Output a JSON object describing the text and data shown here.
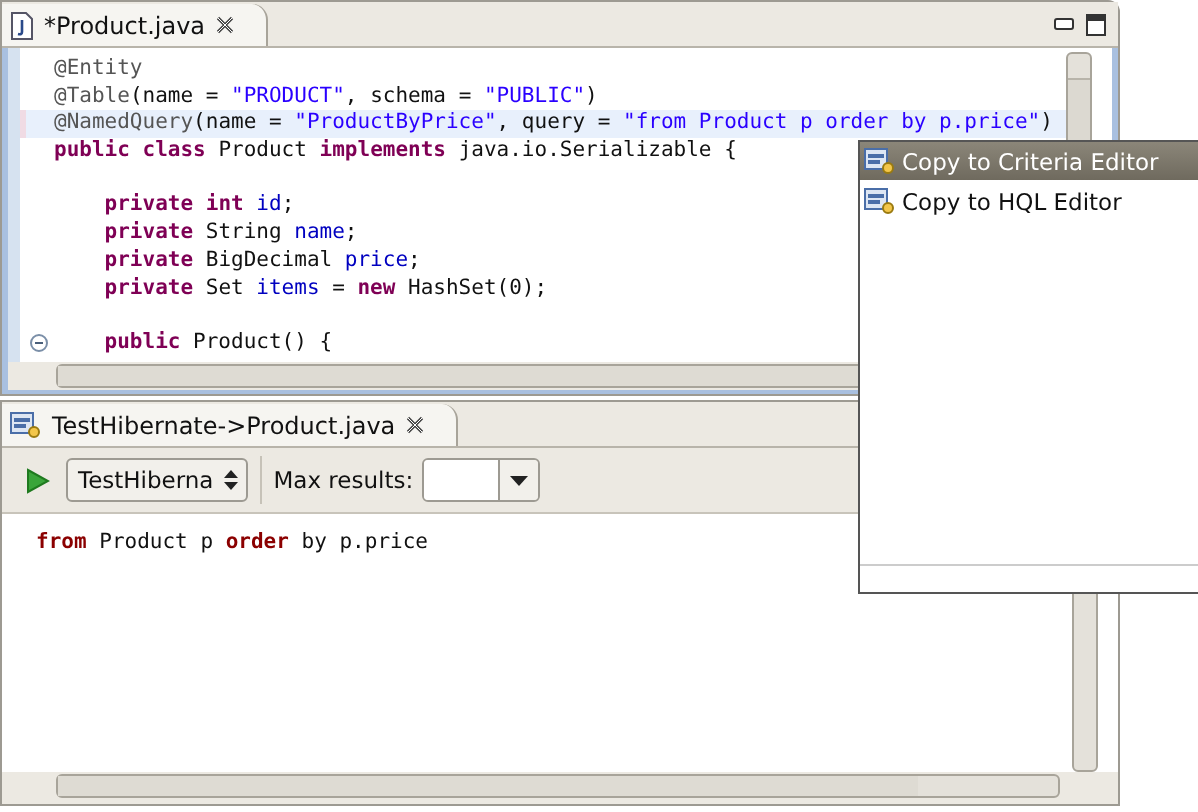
{
  "java_editor": {
    "tab": {
      "title": "*Product.java",
      "selected": true
    },
    "lines": [
      {
        "current": false,
        "tokens": [
          {
            "kind": "annotation",
            "text": "@Entity"
          }
        ]
      },
      {
        "current": false,
        "tokens": [
          {
            "kind": "annotation",
            "text": "@Table"
          },
          {
            "kind": "plain",
            "text": "(name = "
          },
          {
            "kind": "string",
            "text": "\"PRODUCT\""
          },
          {
            "kind": "plain",
            "text": ", schema = "
          },
          {
            "kind": "string",
            "text": "\"PUBLIC\""
          },
          {
            "kind": "plain",
            "text": ")"
          }
        ]
      },
      {
        "current": true,
        "tokens": [
          {
            "kind": "annotation",
            "text": "@NamedQuery"
          },
          {
            "kind": "plain",
            "text": "(name = "
          },
          {
            "kind": "string",
            "text": "\"ProductByPrice\""
          },
          {
            "kind": "plain",
            "text": ", query = "
          },
          {
            "kind": "string",
            "text": "\"from Product p order by p.price\""
          },
          {
            "kind": "plain",
            "text": ")"
          }
        ]
      },
      {
        "current": false,
        "tokens": [
          {
            "kind": "keyword",
            "text": "public"
          },
          {
            "kind": "keyword",
            "text": " class"
          },
          {
            "kind": "plain",
            "text": " Product "
          },
          {
            "kind": "keyword",
            "text": "implements"
          },
          {
            "kind": "plain",
            "text": " java.io.Serializable {"
          }
        ]
      },
      {
        "current": false
      },
      {
        "current": false,
        "tokens": [
          {
            "kind": "keyword",
            "text": "    private"
          },
          {
            "kind": "keyword",
            "text": " int"
          },
          {
            "kind": "field",
            "text": " id"
          },
          {
            "kind": "plain",
            "text": ";"
          }
        ]
      },
      {
        "current": false,
        "tokens": [
          {
            "kind": "keyword",
            "text": "    private"
          },
          {
            "kind": "plain",
            "text": " String "
          },
          {
            "kind": "field",
            "text": "name"
          },
          {
            "kind": "plain",
            "text": ";"
          }
        ]
      },
      {
        "current": false,
        "tokens": [
          {
            "kind": "keyword",
            "text": "    private"
          },
          {
            "kind": "plain",
            "text": " BigDecimal "
          },
          {
            "kind": "field",
            "text": "price"
          },
          {
            "kind": "plain",
            "text": ";"
          }
        ]
      },
      {
        "current": false,
        "tokens": [
          {
            "kind": "keyword",
            "text": "    private"
          },
          {
            "kind": "plain",
            "text": " Set "
          },
          {
            "kind": "field",
            "text": "items"
          },
          {
            "kind": "plain",
            "text": " = "
          },
          {
            "kind": "keyword",
            "text": "new"
          },
          {
            "kind": "plain",
            "text": " HashSet(0);"
          }
        ]
      },
      {
        "current": false
      },
      {
        "current": false,
        "expanded": true,
        "tokens": [
          {
            "kind": "keyword",
            "text": "    public"
          },
          {
            "kind": "plain",
            "text": " Product() {"
          }
        ]
      }
    ]
  },
  "hql_editor": {
    "tab": {
      "title": "TestHibernate->Product.java",
      "selected": true
    },
    "configuration": "TestHiberna",
    "max_results_label": "Max results:",
    "lines": [
      {
        "tokens": [
          {
            "kind": "keyword",
            "text": "from"
          },
          {
            "kind": "plain",
            "text": " Product p "
          },
          {
            "kind": "keyword",
            "text": "order"
          },
          {
            "kind": "plain",
            "text": " by p.price"
          }
        ]
      }
    ]
  },
  "popup_menu": {
    "items": [
      {
        "label": "Copy to Criteria Editor",
        "selected": true
      },
      {
        "label": "Copy to HQL Editor",
        "selected": false
      }
    ]
  }
}
